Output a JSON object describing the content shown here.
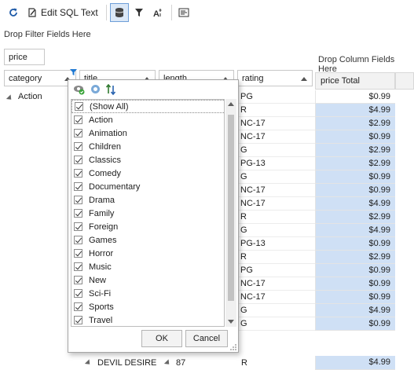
{
  "toolbar": {
    "edit_sql_label": "Edit SQL Text",
    "icons": [
      "refresh-icon",
      "edit-sql-icon",
      "database-icon",
      "filter-icon",
      "font-size-icon",
      "layout-icon"
    ]
  },
  "filter_area": {
    "text": "Drop Filter Fields Here"
  },
  "data_fields": {
    "price": "price"
  },
  "column_area": {
    "text": "Drop Column Fields Here"
  },
  "row_fields": {
    "category": "category",
    "title": "title",
    "length": "length",
    "rating": "rating"
  },
  "price_total_header": "price Total",
  "category_value": "Action",
  "rows": [
    {
      "rating": "PG",
      "price": "$0.99",
      "selected": false
    },
    {
      "rating": "R",
      "price": "$4.99",
      "selected": true
    },
    {
      "rating": "NC-17",
      "price": "$2.99",
      "selected": true
    },
    {
      "rating": "NC-17",
      "price": "$0.99",
      "selected": true
    },
    {
      "rating": "G",
      "price": "$2.99",
      "selected": true
    },
    {
      "rating": "PG-13",
      "price": "$2.99",
      "selected": true
    },
    {
      "rating": "G",
      "price": "$0.99",
      "selected": true
    },
    {
      "rating": "NC-17",
      "price": "$0.99",
      "selected": true
    },
    {
      "rating": "NC-17",
      "price": "$4.99",
      "selected": true
    },
    {
      "rating": "R",
      "price": "$2.99",
      "selected": true
    },
    {
      "rating": "G",
      "price": "$4.99",
      "selected": true
    },
    {
      "rating": "PG-13",
      "price": "$0.99",
      "selected": true
    },
    {
      "rating": "R",
      "price": "$2.99",
      "selected": true
    },
    {
      "rating": "PG",
      "price": "$0.99",
      "selected": true
    },
    {
      "rating": "NC-17",
      "price": "$0.99",
      "selected": true
    },
    {
      "rating": "NC-17",
      "price": "$0.99",
      "selected": true
    },
    {
      "rating": "G",
      "price": "$4.99",
      "selected": true
    },
    {
      "rating": "G",
      "price": "$0.99",
      "selected": true
    }
  ],
  "bottom_row": {
    "title": "DEVIL DESIRE",
    "length": "87",
    "rating": "R",
    "price": "$4.99"
  },
  "filter_popup": {
    "items": [
      "(Show All)",
      "Action",
      "Animation",
      "Children",
      "Classics",
      "Comedy",
      "Documentary",
      "Drama",
      "Family",
      "Foreign",
      "Games",
      "Horror",
      "Music",
      "New",
      "Sci-Fi",
      "Sports",
      "Travel"
    ],
    "ok_label": "OK",
    "cancel_label": "Cancel"
  }
}
